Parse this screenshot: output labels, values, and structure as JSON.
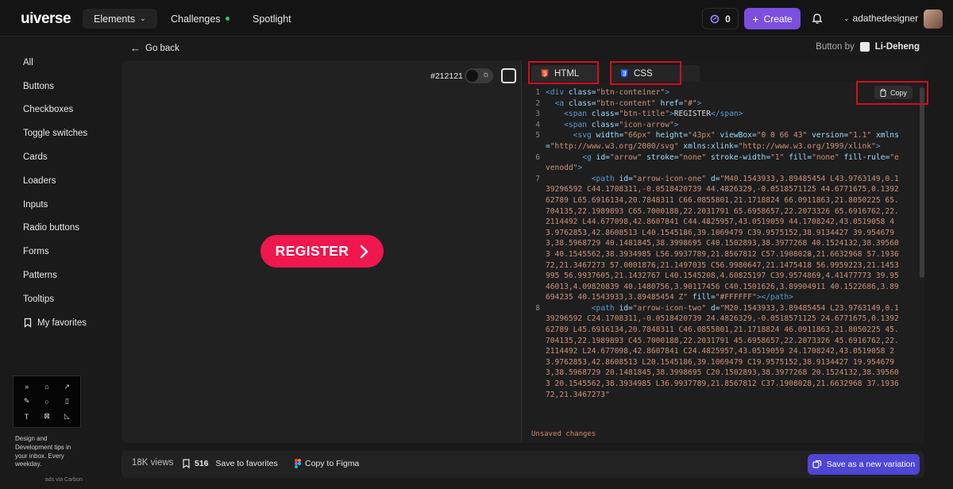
{
  "header": {
    "logo_prefix": "ui",
    "logo_suffix": "verse",
    "nav": {
      "elements": "Elements",
      "challenges": "Challenges",
      "spotlight": "Spotlight"
    },
    "counter": "0",
    "create": "Create",
    "username": "adathedesigner"
  },
  "sidebar": {
    "items": [
      "All",
      "Buttons",
      "Checkboxes",
      "Toggle switches",
      "Cards",
      "Loaders",
      "Inputs",
      "Radio buttons",
      "Forms",
      "Patterns",
      "Tooltips"
    ],
    "favorites": "My favorites"
  },
  "ad": {
    "text": "Design and Development tips in your inbox. Every weekday.",
    "via": "ads via Carbon"
  },
  "topline": {
    "go_back": "Go back",
    "button_by": "Button by",
    "author": "Li-Deheng"
  },
  "preview": {
    "bg_hex": "#212121",
    "button_label": "REGISTER"
  },
  "code_panel": {
    "tabs": {
      "html": "HTML",
      "css": "CSS"
    },
    "copy": "Copy",
    "unsaved": "Unsaved changes",
    "lines": [
      {
        "n": "1",
        "html": "<span class='tg'>&lt;div</span> <span class='at'>class</span>=<span class='st'>\"btn-conteiner\"</span><span class='tg'>&gt;</span>"
      },
      {
        "n": "2",
        "html": "  <span class='tg'>&lt;a</span> <span class='at'>class</span>=<span class='st'>\"btn-content\"</span> <span class='at'>href</span>=<span class='st'>\"#\"</span><span class='tg'>&gt;</span>"
      },
      {
        "n": "3",
        "html": "    <span class='tg'>&lt;span</span> <span class='at'>class</span>=<span class='st'>\"btn-title\"</span><span class='tg'>&gt;</span><span class='tx'>REGISTER</span><span class='tg'>&lt;/span&gt;</span>"
      },
      {
        "n": "4",
        "html": "    <span class='tg'>&lt;span</span> <span class='at'>class</span>=<span class='st'>\"icon-arrow\"</span><span class='tg'>&gt;</span>"
      },
      {
        "n": "5",
        "html": "      <span class='tg'>&lt;svg</span> <span class='at'>width</span>=<span class='st'>\"66px\"</span> <span class='at'>height</span>=<span class='st'>\"43px\"</span> <span class='at'>viewBox</span>=<span class='st'>\"0 0 66 43\"</span> <span class='at'>version</span>=<span class='st'>\"1.1\"</span> <span class='at'>xmlns</span>=<span class='st'>\"http://www.w3.org/2000/svg\"</span> <span class='at'>xmlns:xlink</span>=<span class='st'>\"http://www.w3.org/1999/xlink\"</span><span class='tg'>&gt;</span>"
      },
      {
        "n": "6",
        "html": "        <span class='tg'>&lt;g</span> <span class='at'>id</span>=<span class='st'>\"arrow\"</span> <span class='at'>stroke</span>=<span class='st'>\"none\"</span> <span class='at'>stroke-width</span>=<span class='st'>\"1\"</span> <span class='at'>fill</span>=<span class='st'>\"none\"</span> <span class='at'>fill-rule</span>=<span class='st'>\"evenodd\"</span><span class='tg'>&gt;</span>"
      },
      {
        "n": "7",
        "html": "          <span class='tg'>&lt;path</span> <span class='at'>id</span>=<span class='st'>\"arrow-icon-one\"</span> <span class='at'>d</span>=<span class='st'>\"M40.1543933,3.89485454 L43.9763149,0.139296592 C44.1708311,-0.0518420739 44.4826329,-0.0518571125 44.6771675,0.139262789 L65.6916134,20.7848311 C66.0855801,21.1718824 66.0911863,21.8050225 65.704135,22.1989893 C65.7000188,22.2031791 65.6958657,22.2073326 65.6916762,22.2114492 L44.677098,42.8607841 C44.4825957,43.0519059 44.1708242,43.0519058 43.9762853,42.8608513 L40.1545186,39.1069479 C39.9575152,38.9134427 39.9546793,38.5968729 40.1481845,38.3998695 C40.1502893,38.3977268 40.1524132,38.395603 40.1545562,38.3934985 L56.9937789,21.8567812 C57.1908028,21.6632968 57.193672,21.3467273 57.0001876,21.1497035 C56.9980647,21.1475418 56.9959223,21.1453995 56.9937605,21.1432767 L40.1545208,4.60825197 C39.9574869,4.41477773 39.9546013,4.09820839 40.1480756,3.90117456 C40.1501626,3.89904911 40.1522686,3.89694235 40.1543933,3.89485454 Z\"</span> <span class='at'>fill</span>=<span class='st'>\"#FFFFFF\"</span><span class='tg'>&gt;&lt;/path&gt;</span>"
      },
      {
        "n": "8",
        "html": "          <span class='tg'>&lt;path</span> <span class='at'>id</span>=<span class='st'>\"arrow-icon-two\"</span> <span class='at'>d</span>=<span class='st'>\"M20.1543933,3.89485454 L23.9763149,0.139296592 C24.1708311,-0.0518420739 24.4826329,-0.0518571125 24.6771675,0.139262789 L45.6916134,20.7848311 C46.0855801,21.1718824 46.0911863,21.8050225 45.704135,22.1989893 C45.7000188,22.2031791 45.6958657,22.2073326 45.6916762,22.2114492 L24.677098,42.8607841 C24.4825957,43.0519059 24.1708242,43.0519058 23.9762853,42.8608513 L20.1545186,39.1069479 C19.9575152,38.9134427 19.9546793,38.5968729 20.1481845,38.3998695 C20.1502893,38.3977268 20.1524132,38.395603 20.1545562,38.3934985 L36.9937789,21.8567812 C37.1908028,21.6632968 37.193672,21.3467273\"</span>"
      }
    ]
  },
  "bottom": {
    "views": "18K views",
    "fav_count": "516",
    "fav_label": "Save to favorites",
    "figma": "Copy to Figma",
    "save_variation": "Save as a new variation"
  }
}
